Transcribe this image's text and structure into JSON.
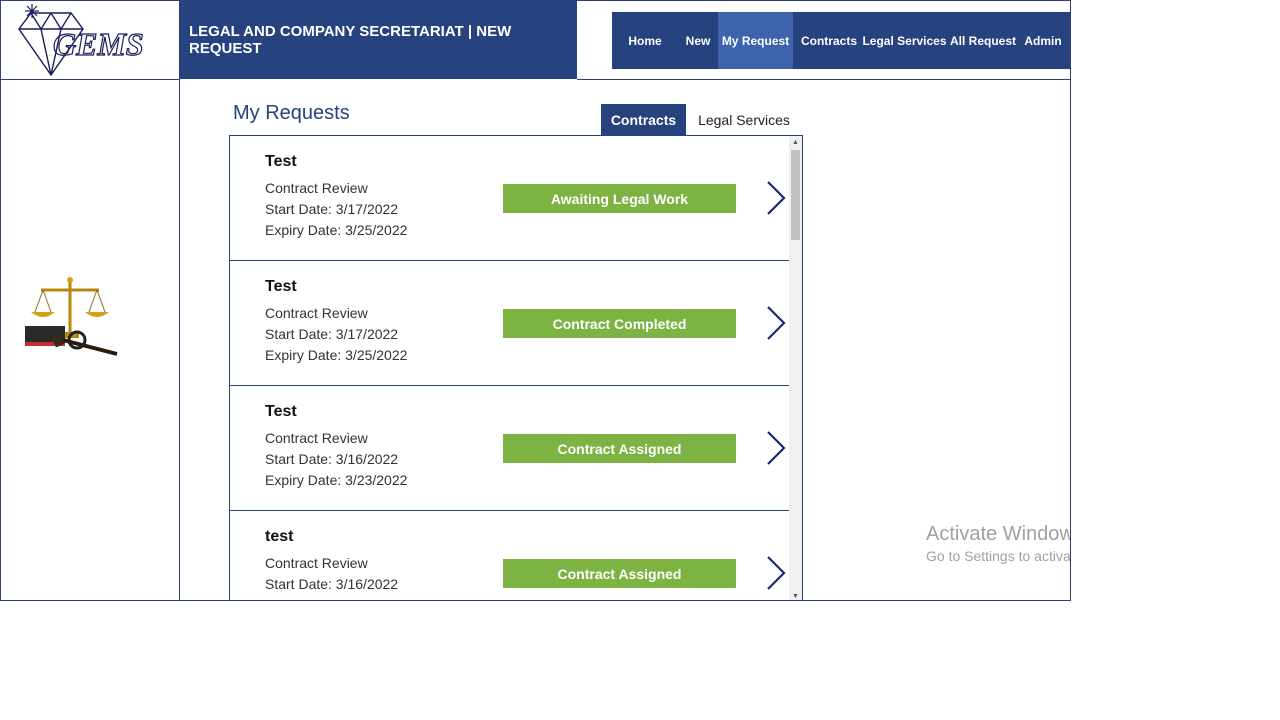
{
  "header": {
    "banner": "LEGAL AND COMPANY SECRETARIAT | NEW REQUEST",
    "logo_text": "GEMS"
  },
  "nav": {
    "items": [
      "Home",
      "New",
      "My Request",
      "Contracts",
      "Legal Services",
      "All Request",
      "Admin"
    ],
    "active": "My Request"
  },
  "page": {
    "title": "My Requests"
  },
  "tabs": {
    "active": "Contracts",
    "inactive": "Legal Services"
  },
  "requests": [
    {
      "title": "Test",
      "type": "Contract Review",
      "start": "Start Date: 3/17/2022",
      "expiry": "Expiry Date: 3/25/2022",
      "status": "Awaiting Legal Work"
    },
    {
      "title": "Test",
      "type": "Contract Review",
      "start": "Start Date: 3/17/2022",
      "expiry": "Expiry Date: 3/25/2022",
      "status": "Contract Completed"
    },
    {
      "title": "Test",
      "type": "Contract Review",
      "start": "Start Date: 3/16/2022",
      "expiry": "Expiry Date: 3/23/2022",
      "status": "Contract Assigned"
    },
    {
      "title": "test",
      "type": "Contract Review",
      "start": "Start Date: 3/16/2022",
      "expiry": "",
      "status": "Contract Assigned"
    }
  ],
  "colors": {
    "primary": "#26427f",
    "active_nav": "#3d63ad",
    "status": "#7cb342",
    "border": "#2f3f7a"
  },
  "watermark": {
    "line1": "Activate Windows",
    "line2": "Go to Settings to activate Windows."
  }
}
